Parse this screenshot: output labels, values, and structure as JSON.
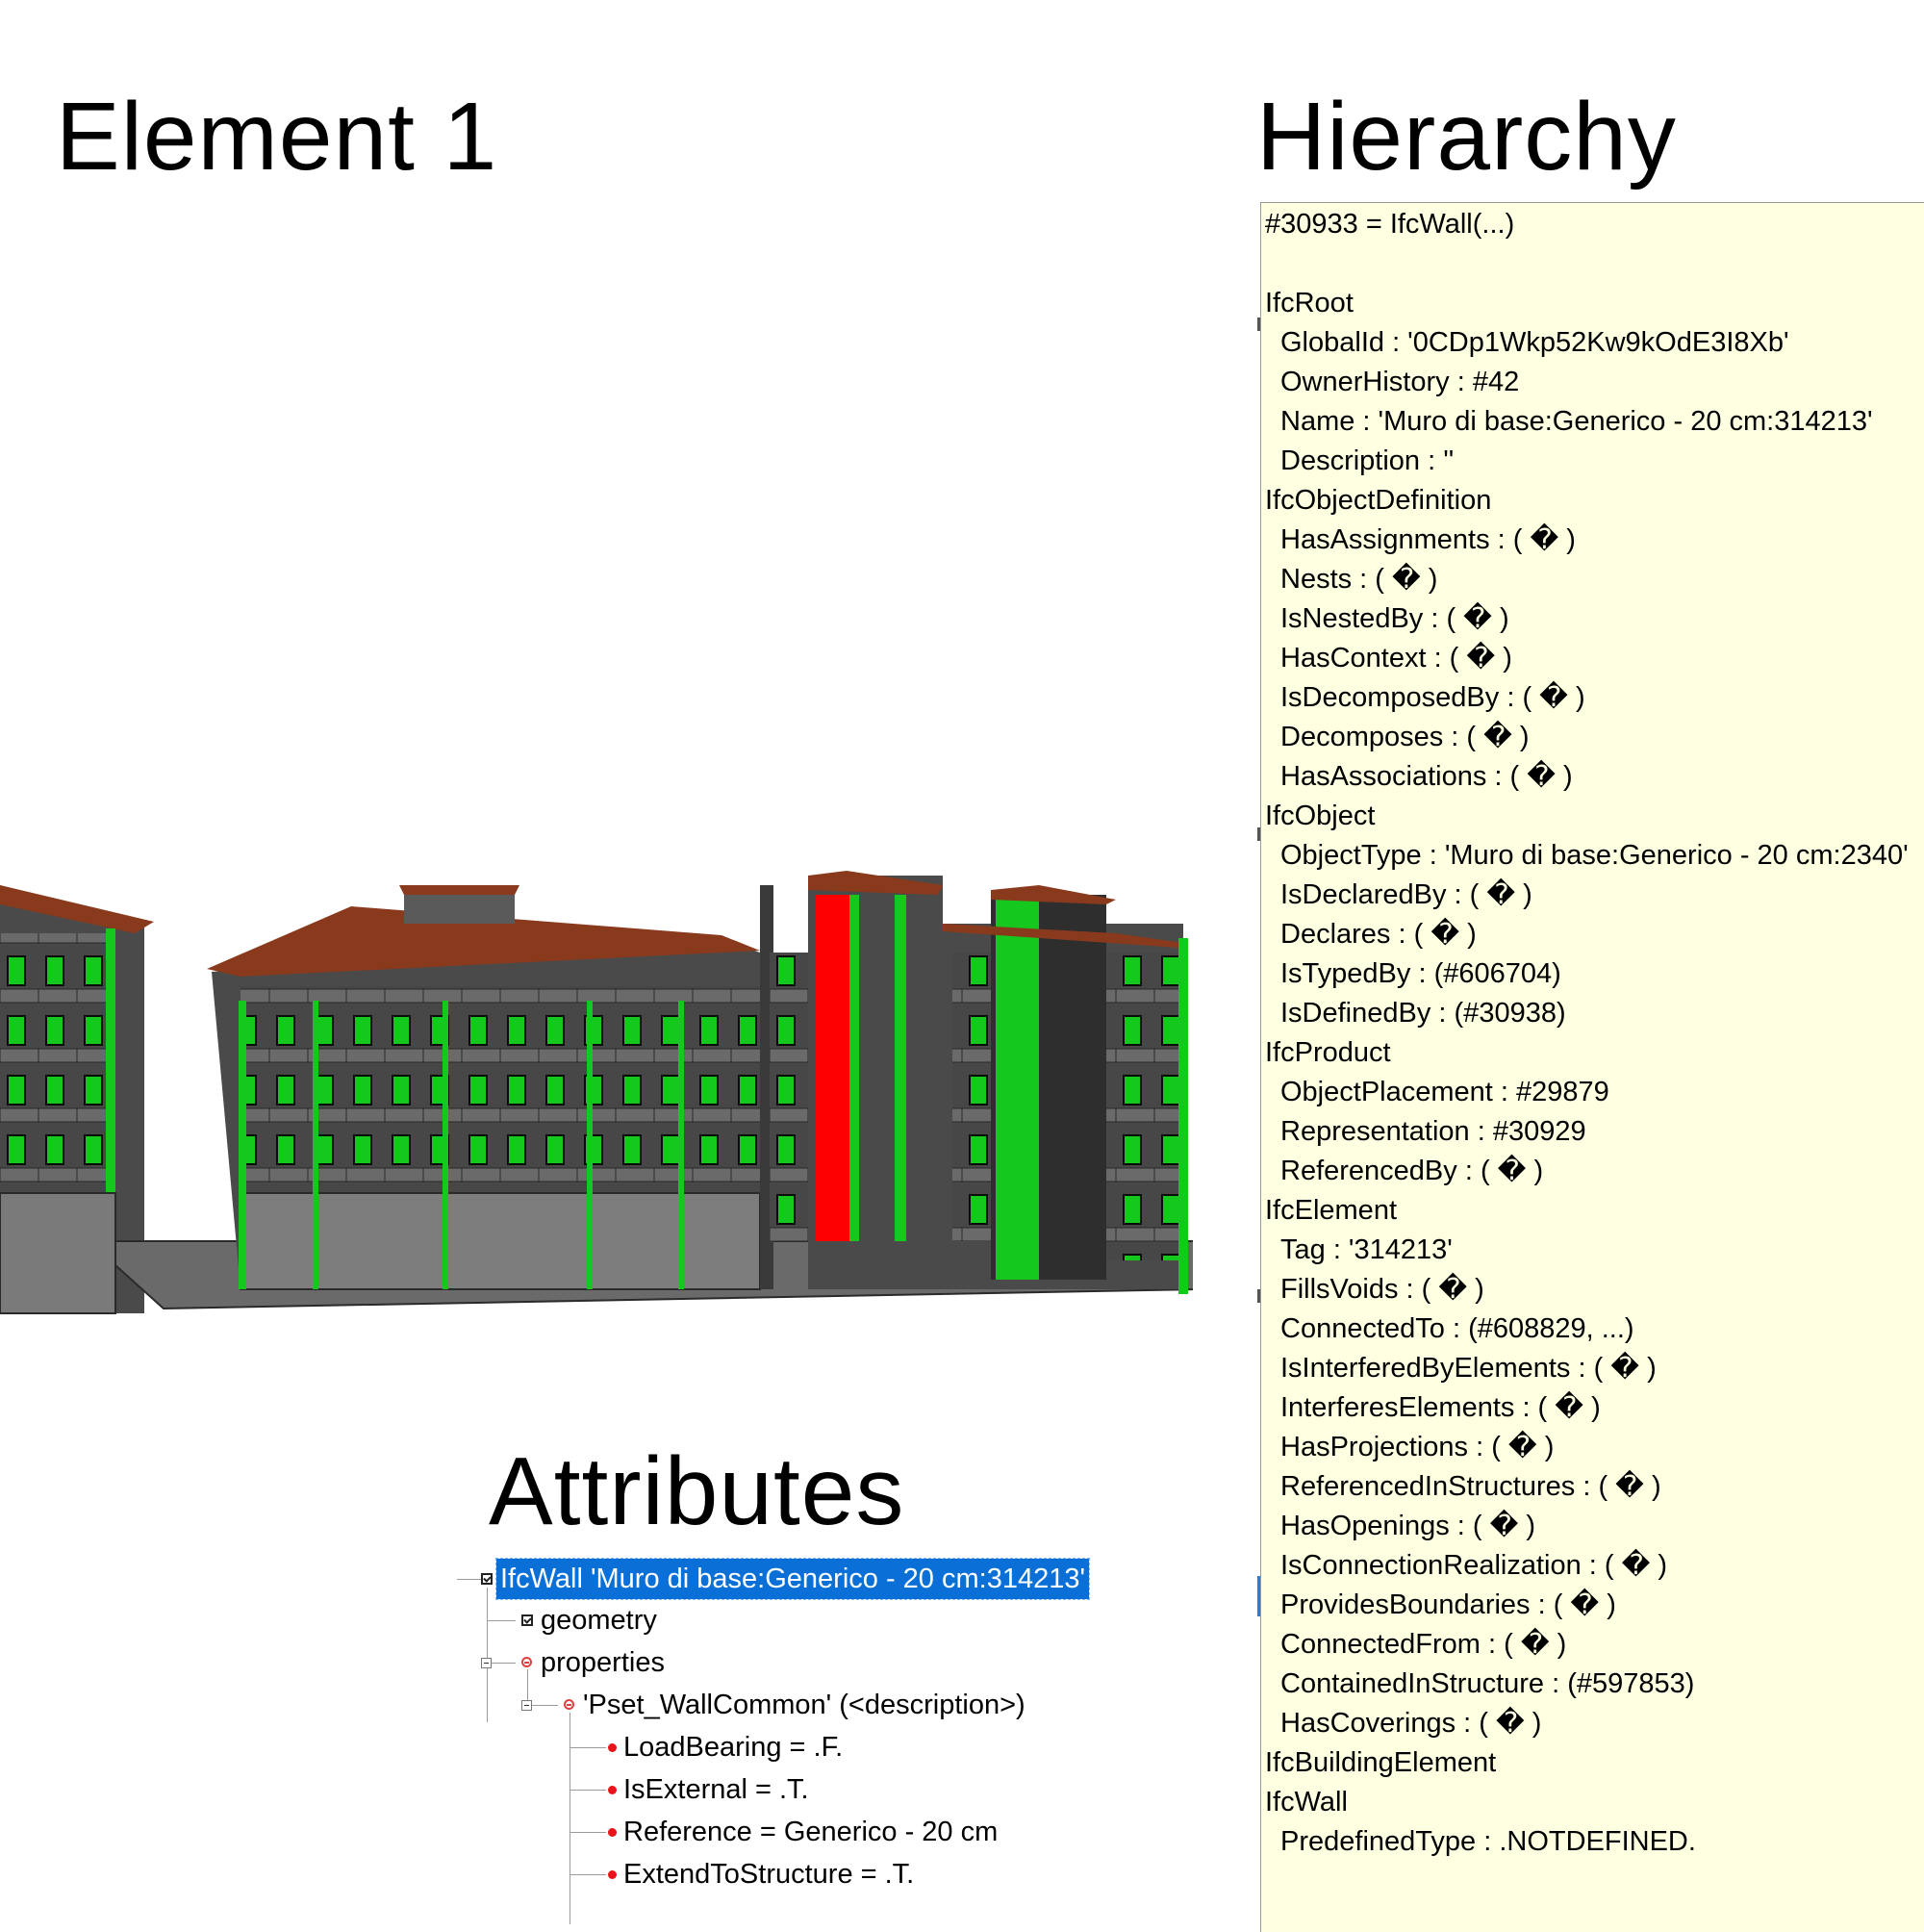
{
  "titles": {
    "element": "Element 1",
    "hierarchy": "Hierarchy",
    "attributes": "Attributes"
  },
  "hierarchy": {
    "lines": [
      {
        "text": "#30933 = IfcWall(...)",
        "indent": false
      },
      {
        "text": "",
        "indent": false
      },
      {
        "text": "IfcRoot",
        "indent": false
      },
      {
        "text": "GlobalId : '0CDp1Wkp52Kw9kOdE3I8Xb'",
        "indent": true
      },
      {
        "text": "OwnerHistory : #42",
        "indent": true
      },
      {
        "text": "Name : 'Muro di base:Generico - 20 cm:314213'",
        "indent": true
      },
      {
        "text": "Description : ''",
        "indent": true
      },
      {
        "text": "IfcObjectDefinition",
        "indent": false
      },
      {
        "text": "HasAssignments : ( � )",
        "indent": true
      },
      {
        "text": "Nests : ( � )",
        "indent": true
      },
      {
        "text": "IsNestedBy : ( � )",
        "indent": true
      },
      {
        "text": "HasContext : ( � )",
        "indent": true
      },
      {
        "text": "IsDecomposedBy : ( � )",
        "indent": true
      },
      {
        "text": "Decomposes : ( � )",
        "indent": true
      },
      {
        "text": "HasAssociations : ( � )",
        "indent": true
      },
      {
        "text": "IfcObject",
        "indent": false
      },
      {
        "text": "ObjectType : 'Muro di base:Generico - 20 cm:2340'",
        "indent": true
      },
      {
        "text": "IsDeclaredBy : ( � )",
        "indent": true
      },
      {
        "text": "Declares : ( � )",
        "indent": true
      },
      {
        "text": "IsTypedBy : (#606704)",
        "indent": true
      },
      {
        "text": "IsDefinedBy : (#30938)",
        "indent": true
      },
      {
        "text": "IfcProduct",
        "indent": false
      },
      {
        "text": "ObjectPlacement : #29879",
        "indent": true
      },
      {
        "text": "Representation : #30929",
        "indent": true
      },
      {
        "text": "ReferencedBy : ( � )",
        "indent": true
      },
      {
        "text": "IfcElement",
        "indent": false
      },
      {
        "text": "Tag : '314213'",
        "indent": true
      },
      {
        "text": "FillsVoids : ( � )",
        "indent": true
      },
      {
        "text": "ConnectedTo : (#608829, ...)",
        "indent": true
      },
      {
        "text": "IsInterferedByElements : ( � )",
        "indent": true
      },
      {
        "text": "InterferesElements : ( � )",
        "indent": true
      },
      {
        "text": "HasProjections : ( � )",
        "indent": true
      },
      {
        "text": "ReferencedInStructures : ( � )",
        "indent": true
      },
      {
        "text": "HasOpenings : ( � )",
        "indent": true
      },
      {
        "text": "IsConnectionRealization : ( � )",
        "indent": true
      },
      {
        "text": "ProvidesBoundaries : ( � )",
        "indent": true
      },
      {
        "text": "ConnectedFrom : ( � )",
        "indent": true
      },
      {
        "text": "ContainedInStructure : (#597853)",
        "indent": true
      },
      {
        "text": "HasCoverings : ( � )",
        "indent": true
      },
      {
        "text": "IfcBuildingElement",
        "indent": false
      },
      {
        "text": "IfcWall",
        "indent": false
      },
      {
        "text": "PredefinedType : .NOTDEFINED.",
        "indent": true
      }
    ]
  },
  "attributes": {
    "root": "IfcWall 'Muro di base:Generico - 20 cm:314213'",
    "geometry": "geometry",
    "properties": "properties",
    "pset": "'Pset_WallCommon' (<description>)",
    "props": [
      "LoadBearing = .F.",
      "IsExternal = .T.",
      "Reference = Generico - 20 cm",
      "ExtendToStructure = .T."
    ]
  },
  "colors": {
    "wall_green": "#14c81e",
    "wall_red": "#ff0000",
    "wall_grey": "#4a4a4a",
    "roof": "#8a3a1c",
    "selection": "#0a70d8",
    "tooltip_bg": "#ffffe1"
  }
}
